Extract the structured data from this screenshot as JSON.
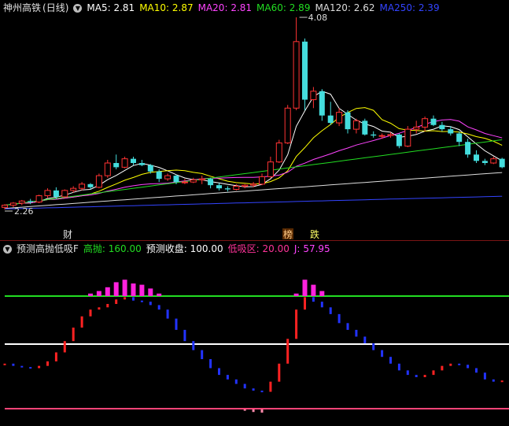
{
  "top_panel": {
    "stock_name": "神州高铁",
    "period": "(日线)",
    "ma5": {
      "label": "MA5:",
      "value": "2.81",
      "color": "#ffffff"
    },
    "ma10": {
      "label": "MA10:",
      "value": "2.87",
      "color": "#ffff00"
    },
    "ma20": {
      "label": "MA20:",
      "value": "2.81",
      "color": "#ff44ff"
    },
    "ma60": {
      "label": "MA60:",
      "value": "2.89",
      "color": "#22dd22"
    },
    "ma120": {
      "label": "MA120:",
      "value": "2.62",
      "color": "#dddddd"
    },
    "ma250": {
      "label": "MA250:",
      "value": "2.39",
      "color": "#3344ff"
    },
    "high_marker": "4.08",
    "low_marker": "2.26",
    "event_labels": [
      "财",
      "榜",
      "跌"
    ]
  },
  "bottom_panel": {
    "indicator_name": "预测高抛低吸F",
    "high_sell": {
      "label": "高抛:",
      "value": "160.00",
      "color": "#22dd22"
    },
    "predict_close": {
      "label": "预测收盘:",
      "value": "100.00",
      "color": "#ffffff"
    },
    "low_buy": {
      "label": "低吸区:",
      "value": "20.00",
      "color": "#ff3399"
    },
    "j": {
      "label": "J:",
      "value": "57.95",
      "color": "#ff44ff"
    }
  },
  "chart_data": {
    "type": "candlestick",
    "price_range": [
      2.26,
      4.08
    ],
    "candles": [
      [
        2.28,
        2.31,
        2.26,
        2.3
      ],
      [
        2.3,
        2.33,
        2.28,
        2.32
      ],
      [
        2.32,
        2.35,
        2.3,
        2.34
      ],
      [
        2.34,
        2.36,
        2.31,
        2.33
      ],
      [
        2.33,
        2.4,
        2.32,
        2.39
      ],
      [
        2.39,
        2.46,
        2.37,
        2.44
      ],
      [
        2.44,
        2.47,
        2.36,
        2.38
      ],
      [
        2.38,
        2.45,
        2.37,
        2.44
      ],
      [
        2.44,
        2.48,
        2.42,
        2.46
      ],
      [
        2.46,
        2.52,
        2.44,
        2.5
      ],
      [
        2.5,
        2.51,
        2.45,
        2.47
      ],
      [
        2.47,
        2.6,
        2.46,
        2.58
      ],
      [
        2.58,
        2.73,
        2.56,
        2.7
      ],
      [
        2.7,
        2.78,
        2.64,
        2.66
      ],
      [
        2.66,
        2.76,
        2.65,
        2.74
      ],
      [
        2.74,
        2.76,
        2.68,
        2.7
      ],
      [
        2.7,
        2.73,
        2.67,
        2.68
      ],
      [
        2.68,
        2.69,
        2.6,
        2.62
      ],
      [
        2.62,
        2.64,
        2.52,
        2.55
      ],
      [
        2.55,
        2.6,
        2.53,
        2.58
      ],
      [
        2.58,
        2.59,
        2.5,
        2.52
      ],
      [
        2.52,
        2.55,
        2.5,
        2.52
      ],
      [
        2.52,
        2.56,
        2.51,
        2.54
      ],
      [
        2.54,
        2.58,
        2.5,
        2.55
      ],
      [
        2.55,
        2.56,
        2.46,
        2.49
      ],
      [
        2.49,
        2.51,
        2.44,
        2.46
      ],
      [
        2.46,
        2.48,
        2.43,
        2.45
      ],
      [
        2.45,
        2.5,
        2.44,
        2.48
      ],
      [
        2.48,
        2.5,
        2.46,
        2.49
      ],
      [
        2.49,
        2.52,
        2.47,
        2.5
      ],
      [
        2.5,
        2.6,
        2.49,
        2.57
      ],
      [
        2.57,
        2.76,
        2.56,
        2.71
      ],
      [
        2.71,
        2.92,
        2.7,
        2.89
      ],
      [
        2.89,
        3.25,
        2.88,
        3.22
      ],
      [
        3.22,
        4.08,
        3.2,
        3.85
      ],
      [
        3.85,
        3.88,
        3.2,
        3.3
      ],
      [
        3.3,
        3.42,
        3.22,
        3.38
      ],
      [
        3.38,
        3.4,
        3.1,
        3.15
      ],
      [
        3.15,
        3.28,
        3.06,
        3.08
      ],
      [
        3.08,
        3.22,
        3.05,
        3.18
      ],
      [
        3.18,
        3.2,
        2.98,
        3.02
      ],
      [
        3.02,
        3.12,
        2.98,
        3.1
      ],
      [
        3.1,
        3.12,
        2.96,
        2.97
      ],
      [
        2.97,
        3.0,
        2.94,
        2.96
      ],
      [
        2.96,
        2.98,
        2.93,
        2.96
      ],
      [
        2.96,
        2.99,
        2.94,
        2.97
      ],
      [
        2.97,
        2.98,
        2.84,
        2.86
      ],
      [
        2.86,
        3.05,
        2.85,
        3.02
      ],
      [
        3.02,
        3.1,
        2.98,
        3.04
      ],
      [
        3.04,
        3.14,
        3.0,
        3.12
      ],
      [
        3.12,
        3.15,
        3.05,
        3.06
      ],
      [
        3.06,
        3.09,
        3.0,
        3.02
      ],
      [
        3.02,
        3.05,
        2.96,
        2.98
      ],
      [
        2.98,
        3.0,
        2.86,
        2.9
      ],
      [
        2.9,
        2.93,
        2.75,
        2.78
      ],
      [
        2.78,
        2.82,
        2.7,
        2.72
      ],
      [
        2.72,
        2.74,
        2.68,
        2.7
      ],
      [
        2.7,
        2.76,
        2.69,
        2.74
      ],
      [
        2.74,
        2.75,
        2.65,
        2.66
      ]
    ],
    "indicator_j": [
      40,
      38,
      37,
      36,
      38,
      42,
      50,
      60,
      72,
      82,
      88,
      90,
      93,
      97,
      99,
      96,
      95,
      92,
      88,
      80,
      70,
      60,
      52,
      44,
      36,
      30,
      26,
      22,
      18,
      16,
      15,
      24,
      40,
      62,
      88,
      99,
      95,
      90,
      84,
      76,
      70,
      64,
      58,
      52,
      46,
      40,
      34,
      30,
      28,
      30,
      34,
      38,
      40,
      39,
      36,
      32,
      26,
      24,
      25
    ],
    "indicator_high": 160,
    "indicator_predict": 100,
    "indicator_low": 20
  }
}
